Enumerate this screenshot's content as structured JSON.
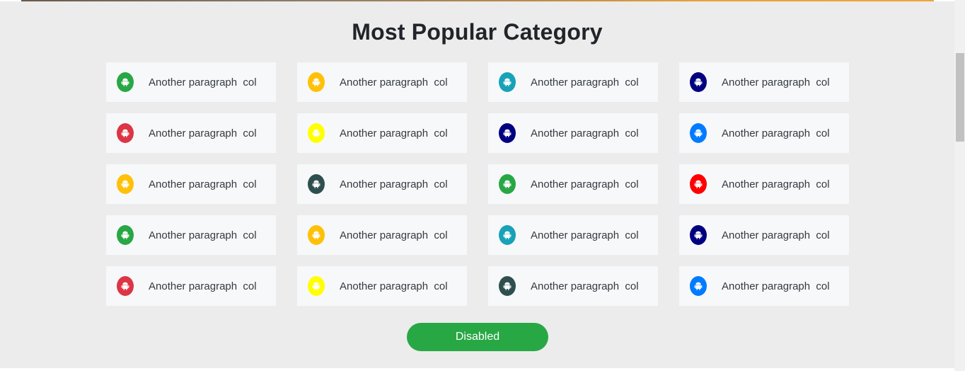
{
  "section": {
    "title": "Most Popular Category",
    "button_label": "Disabled",
    "button_color": "#28a745"
  },
  "cards": [
    {
      "label": "Another paragraph  col",
      "color": "#28a745",
      "icon": "android-icon"
    },
    {
      "label": "Another paragraph  col",
      "color": "#ffc107",
      "icon": "android-icon"
    },
    {
      "label": "Another paragraph  col",
      "color": "#17a2b8",
      "icon": "android-icon"
    },
    {
      "label": "Another paragraph  col",
      "color": "#000080",
      "icon": "android-icon"
    },
    {
      "label": "Another paragraph  col",
      "color": "#dc3545",
      "icon": "android-icon"
    },
    {
      "label": "Another paragraph  col",
      "color": "#ffff00",
      "icon": "android-icon"
    },
    {
      "label": "Another paragraph  col",
      "color": "#000080",
      "icon": "android-icon"
    },
    {
      "label": "Another paragraph  col",
      "color": "#007bff",
      "icon": "android-icon"
    },
    {
      "label": "Another paragraph  col",
      "color": "#ffc107",
      "icon": "android-icon"
    },
    {
      "label": "Another paragraph  col",
      "color": "#2f4f4f",
      "icon": "android-icon"
    },
    {
      "label": "Another paragraph  col",
      "color": "#28a745",
      "icon": "android-icon"
    },
    {
      "label": "Another paragraph  col",
      "color": "#ff0000",
      "icon": "android-icon"
    },
    {
      "label": "Another paragraph  col",
      "color": "#28a745",
      "icon": "android-icon"
    },
    {
      "label": "Another paragraph  col",
      "color": "#ffc107",
      "icon": "android-icon"
    },
    {
      "label": "Another paragraph  col",
      "color": "#17a2b8",
      "icon": "android-icon"
    },
    {
      "label": "Another paragraph  col",
      "color": "#000080",
      "icon": "android-icon"
    },
    {
      "label": "Another paragraph  col",
      "color": "#dc3545",
      "icon": "android-icon"
    },
    {
      "label": "Another paragraph  col",
      "color": "#ffff00",
      "icon": "android-icon"
    },
    {
      "label": "Another paragraph  col",
      "color": "#2f4f4f",
      "icon": "android-icon"
    },
    {
      "label": "Another paragraph  col",
      "color": "#007bff",
      "icon": "android-icon"
    }
  ]
}
